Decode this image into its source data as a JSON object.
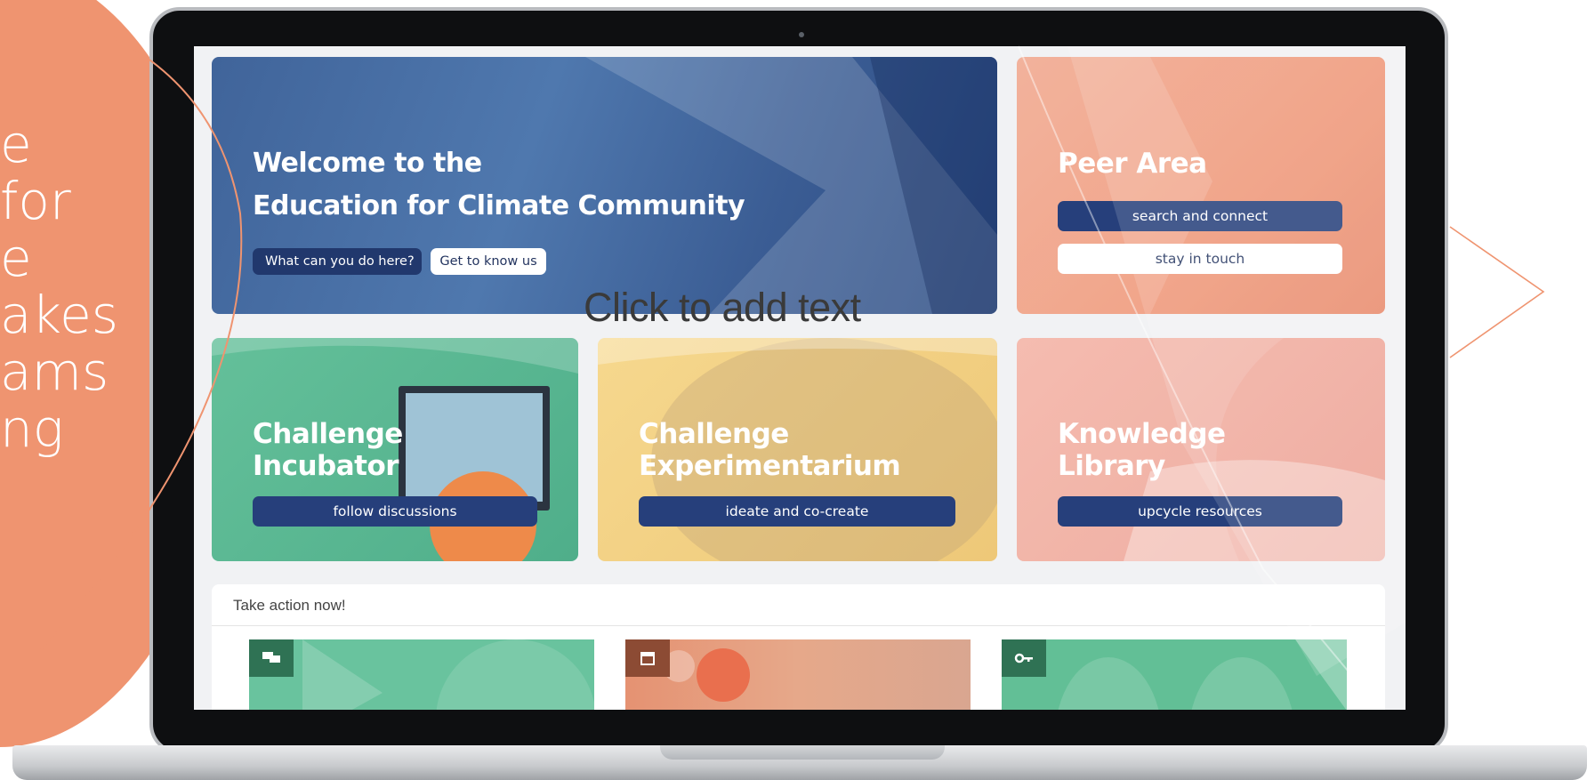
{
  "left_panel": {
    "lines": [
      "e",
      " for",
      "e",
      "akes",
      "ams",
      "ng"
    ]
  },
  "hero": {
    "title_line1": "Welcome to the",
    "title_line2": "Education for Climate Community",
    "btn_what": "What can you do here?",
    "btn_know": "Get to know us"
  },
  "overlay": {
    "placeholder": "Click to add text"
  },
  "peer": {
    "title": "Peer Area",
    "btn_search": "search and connect",
    "btn_touch": "stay in touch"
  },
  "incubator": {
    "title_line1": "Challenge",
    "title_line2": "Incubator",
    "btn": "follow discussions"
  },
  "experimentarium": {
    "title_line1": "Challenge",
    "title_line2": "Experimentarium",
    "btn": "ideate and co-create"
  },
  "library": {
    "title_line1": "Knowledge",
    "title_line2": "Library",
    "btn": "upcycle resources"
  },
  "action": {
    "heading": "Take action now!",
    "tiles": [
      {
        "icon": "discussion-icon"
      },
      {
        "icon": "calendar-icon"
      },
      {
        "icon": "key-icon"
      }
    ]
  },
  "colors": {
    "salmon": "#ef9470",
    "navy_button": "#263f7b",
    "hero_blue": "#4f78ae",
    "peer_orange": "#ef9778",
    "incubator_green": "#4fae8a",
    "experimentarium_yellow": "#f6d88e",
    "library_pink": "#f4b3a5"
  }
}
